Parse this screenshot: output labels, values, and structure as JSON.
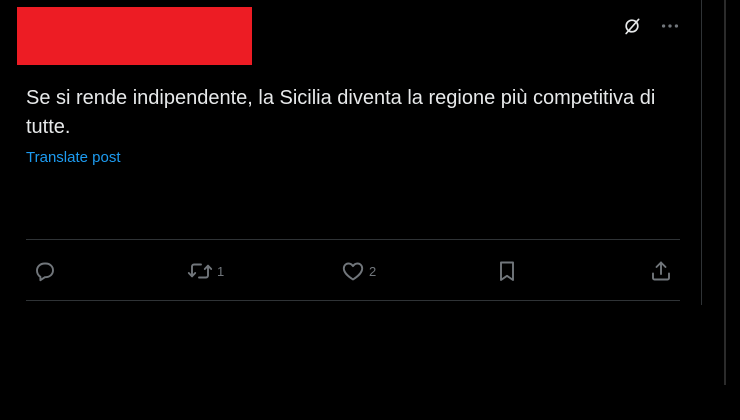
{
  "post": {
    "text": "Se si rende indipendente, la Sicilia diventa la regione più competitiva di tutte.",
    "translate_label": "Translate post",
    "redaction_color": "#ed1c24",
    "link_color": "#1d9bf0",
    "muted_color": "#71767b",
    "grok_icon": "grok-icon",
    "more_icon": "more-icon"
  },
  "actions": {
    "reply": {
      "icon": "reply-icon",
      "count": ""
    },
    "repost": {
      "icon": "repost-icon",
      "count": "1"
    },
    "like": {
      "icon": "heart-icon",
      "count": "2"
    },
    "bookmark": {
      "icon": "bookmark-icon"
    },
    "share": {
      "icon": "share-icon"
    }
  }
}
